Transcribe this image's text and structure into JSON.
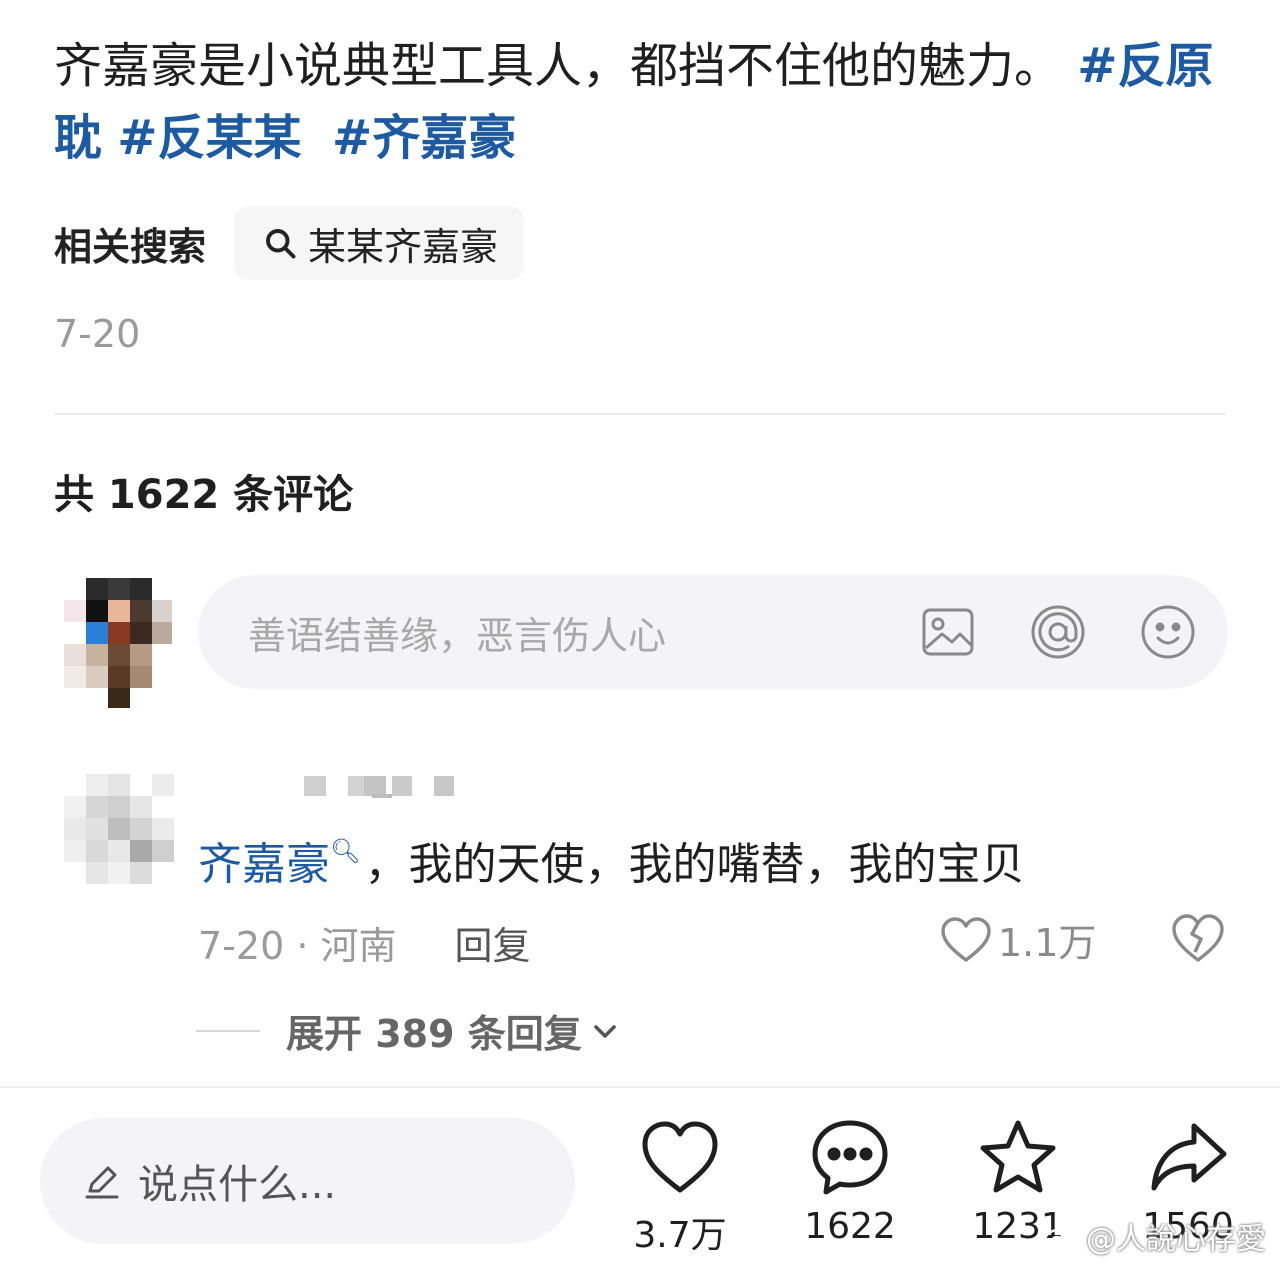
{
  "post": {
    "text": "齐嘉豪是小说典型工具人，都挡不住他的魅力。",
    "tags": [
      "#反原耽",
      "#反某某",
      "#齐嘉豪"
    ],
    "date": "7-20"
  },
  "related": {
    "label": "相关搜索",
    "query": "某某齐嘉豪",
    "icon": "search-icon"
  },
  "comments_header": {
    "text": "共 1622 条评论"
  },
  "comment_input": {
    "placeholder": "善语结善缘，恶言伤人心",
    "icons": [
      "image-icon",
      "at-icon",
      "emoji-icon"
    ]
  },
  "comment": {
    "mention": "齐嘉豪",
    "text": "，我的天使，我的嘴替，我的宝贝",
    "meta": "7-20 · 河南",
    "reply_label": "回复",
    "likes": "1.1万",
    "expand_label": "展开 389 条回复"
  },
  "bottom_bar": {
    "say_placeholder": "说点什么...",
    "like_count": "3.7万",
    "comment_count": "1622",
    "star_count": "1231",
    "share_count": "1560"
  },
  "watermark": {
    "text": "@人說心存愛"
  },
  "colors": {
    "link": "#1e5aa0",
    "muted": "#9a9a9a",
    "input_bg": "#f4f4f6"
  }
}
